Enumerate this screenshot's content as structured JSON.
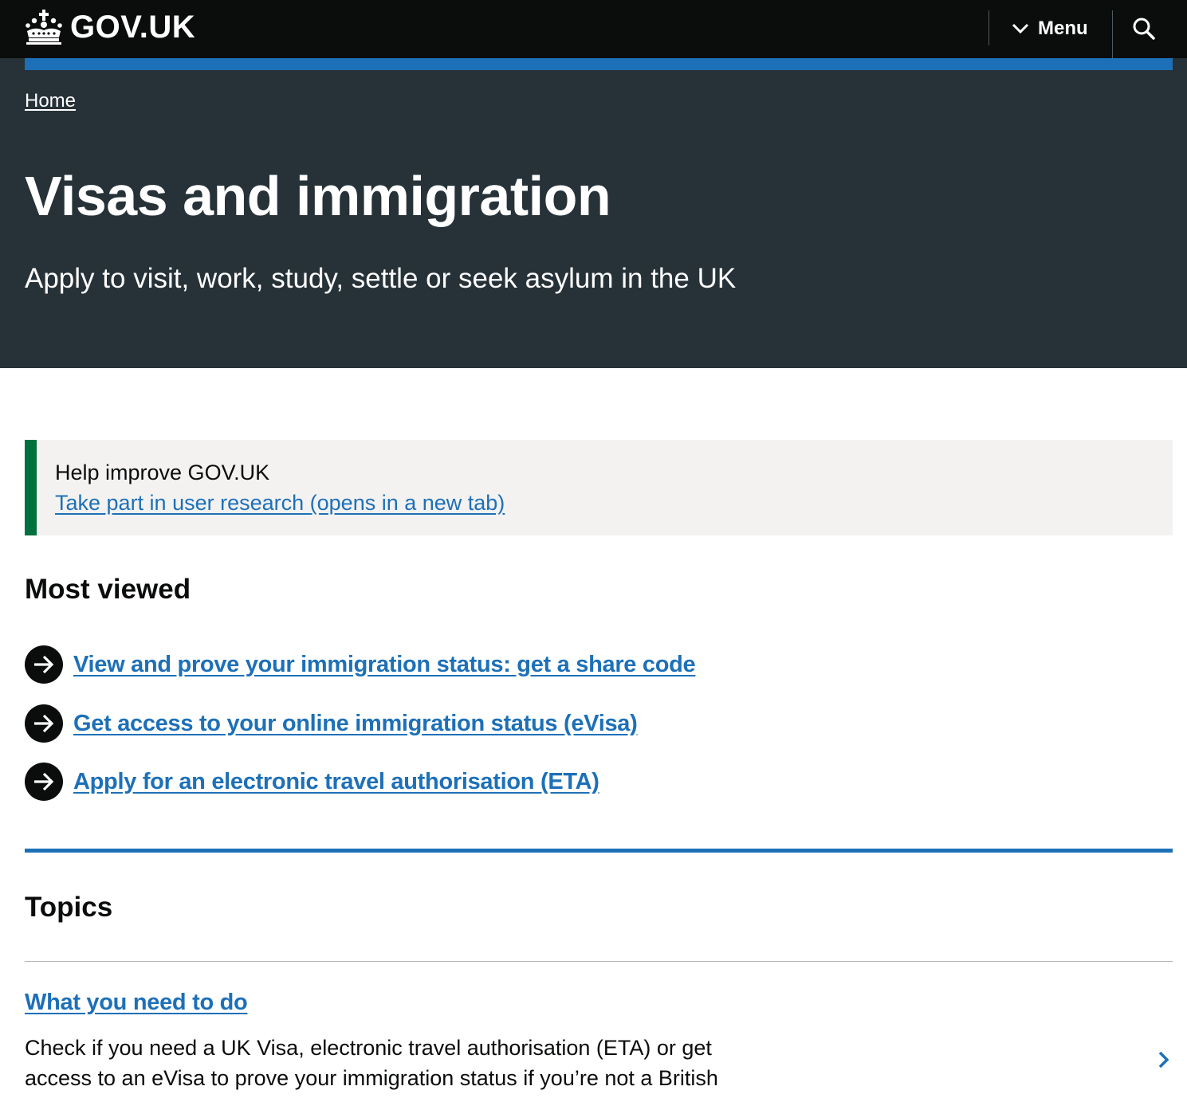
{
  "header": {
    "logo_text": "GOV.UK",
    "menu_label": "Menu",
    "icons": [
      "crown-icon",
      "chevron-down-icon",
      "search-icon"
    ]
  },
  "hero": {
    "breadcrumb": "Home",
    "title": "Visas and immigration",
    "lede": "Apply to visit, work, study, settle or seek asylum in the UK"
  },
  "banner": {
    "title": "Help improve GOV.UK",
    "link": "Take part in user research (opens in a new tab)"
  },
  "most_viewed": {
    "heading": "Most viewed",
    "items": [
      {
        "label": "View and prove your immigration status: get a share code"
      },
      {
        "label": "Get access to your online immigration status (eVisa)"
      },
      {
        "label": "Apply for an electronic travel authorisation (ETA)"
      }
    ]
  },
  "topics": {
    "heading": "Topics",
    "items": [
      {
        "title": "What you need to do",
        "description": "Check if you need a UK Visa, electronic travel authorisation (ETA) or get access to an eVisa to prove your immigration status if you’re not a British"
      }
    ]
  },
  "colors": {
    "header_bg": "#0b0c0c",
    "hero_bg": "#263238",
    "accent_blue": "#1d70b8",
    "banner_green": "#00703c",
    "banner_bg": "#f3f2f1",
    "text": "#0b0c0c"
  }
}
